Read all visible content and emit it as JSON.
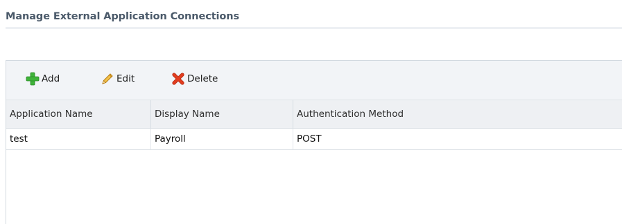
{
  "section": {
    "title": "Manage External Application Connections"
  },
  "toolbar": {
    "add_label": "Add",
    "add_icon": "plus-icon",
    "edit_label": "Edit",
    "edit_icon": "pencil-icon",
    "delete_label": "Delete",
    "delete_icon": "x-icon"
  },
  "table": {
    "columns": [
      "Application Name",
      "Display Name",
      "Authentication Method"
    ],
    "rows": [
      [
        "test",
        "Payroll",
        "POST"
      ]
    ]
  },
  "colors": {
    "add_icon": "#3fb33a",
    "edit_icon": "#e0a21b",
    "delete_icon": "#e23d1f",
    "title_text": "#4b5a6a",
    "toolbar_bg": "#f2f4f7"
  }
}
